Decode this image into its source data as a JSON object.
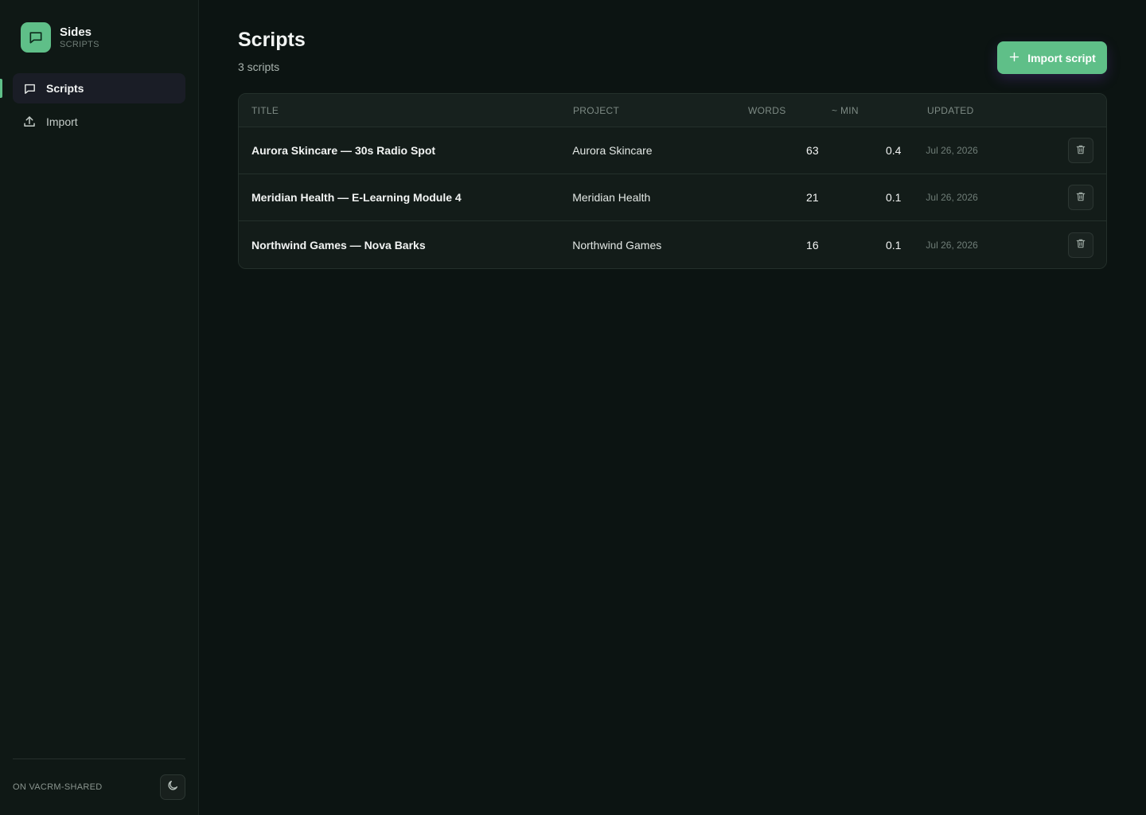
{
  "brand": {
    "name": "Sides",
    "subtitle": "SCRIPTS",
    "logo_icon": "chat-bubble-icon",
    "accent": "#5fbf88"
  },
  "sidebar": {
    "items": [
      {
        "label": "Scripts",
        "icon": "chat-bubble-icon",
        "active": true
      },
      {
        "label": "Import",
        "icon": "upload-icon",
        "active": false
      }
    ],
    "footer_label": "ON VACRM-SHARED",
    "theme_toggle_icon": "moon-icon"
  },
  "main": {
    "title": "Scripts",
    "count_text": "3 scripts",
    "import_button": {
      "label": "Import script",
      "icon": "plus-icon"
    }
  },
  "table": {
    "columns": [
      "TITLE",
      "PROJECT",
      "WORDS",
      "~ MIN",
      "UPDATED"
    ],
    "rows": [
      {
        "title": "Aurora Skincare — 30s Radio Spot",
        "project": "Aurora Skincare",
        "words": "63",
        "min": "0.4",
        "updated": "Jul 26, 2026"
      },
      {
        "title": "Meridian Health — E-Learning Module 4",
        "project": "Meridian Health",
        "words": "21",
        "min": "0.1",
        "updated": "Jul 26, 2026"
      },
      {
        "title": "Northwind Games — Nova Barks",
        "project": "Northwind Games",
        "words": "16",
        "min": "0.1",
        "updated": "Jul 26, 2026"
      }
    ],
    "row_action_icon": "trash-icon"
  }
}
